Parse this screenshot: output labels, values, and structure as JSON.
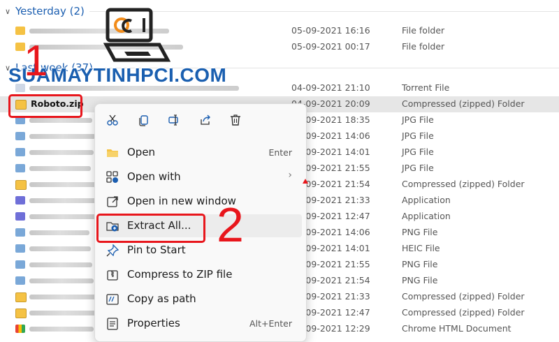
{
  "groups": [
    {
      "label": "Yesterday (2)"
    },
    {
      "label": "Last week (37)"
    }
  ],
  "yesterday_rows": [
    {
      "date": "05-09-2021 16:16",
      "type": "File folder",
      "icon": "folder-icon"
    },
    {
      "date": "05-09-2021 00:17",
      "type": "File folder",
      "icon": "folder-icon"
    }
  ],
  "lastweek_rows": [
    {
      "date": "04-09-2021 21:10",
      "type": "Torrent File",
      "icon": "file-icon"
    },
    {
      "name": "Roboto.zip",
      "date": "04-09-2021 20:09",
      "type": "Compressed (zipped) Folder",
      "icon": "zip-folder-icon",
      "selected": true
    },
    {
      "date": "04-09-2021 18:35",
      "type": "JPG File",
      "icon": "image-icon"
    },
    {
      "date": "04-09-2021 14:06",
      "type": "JPG File",
      "icon": "image-icon"
    },
    {
      "date": "04-09-2021 14:01",
      "type": "JPG File",
      "icon": "image-icon"
    },
    {
      "date": "04-09-2021 21:55",
      "type": "JPG File",
      "icon": "image-icon"
    },
    {
      "date": "04-09-2021 21:54",
      "type": "Compressed (zipped) Folder",
      "icon": "zip-folder-icon"
    },
    {
      "date": "04-09-2021 21:33",
      "type": "Application",
      "icon": "app-icon"
    },
    {
      "date": "04-09-2021 12:47",
      "type": "Application",
      "icon": "app-icon"
    },
    {
      "date": "04-09-2021 14:06",
      "type": "PNG File",
      "icon": "image-icon"
    },
    {
      "date": "04-09-2021 14:01",
      "type": "HEIC File",
      "icon": "image-icon"
    },
    {
      "date": "04-09-2021 21:55",
      "type": "PNG File",
      "icon": "image-icon"
    },
    {
      "date": "04-09-2021 21:54",
      "type": "PNG File",
      "icon": "image-icon"
    },
    {
      "date": "04-09-2021 21:33",
      "type": "Compressed (zipped) Folder",
      "icon": "zip-folder-icon"
    },
    {
      "date": "04-09-2021 12:47",
      "type": "Compressed (zipped) Folder",
      "icon": "zip-folder-icon"
    },
    {
      "date": "04-09-2021 12:29",
      "type": "Chrome HTML Document",
      "icon": "html-icon"
    }
  ],
  "context_menu": {
    "toolbar": [
      {
        "icon": "cut-icon"
      },
      {
        "icon": "copy-icon"
      },
      {
        "icon": "rename-icon"
      },
      {
        "icon": "share-icon"
      },
      {
        "icon": "delete-icon"
      }
    ],
    "items": [
      {
        "label": "Open",
        "shortcut": "Enter",
        "icon": "folder-open-icon"
      },
      {
        "label": "Open with",
        "shortcut": "",
        "icon": "open-with-icon",
        "submenu": true
      },
      {
        "label": "Open in new window",
        "shortcut": "",
        "icon": "new-window-icon"
      },
      {
        "label": "Extract All...",
        "shortcut": "",
        "icon": "extract-icon",
        "highlighted": true
      },
      {
        "label": "Pin to Start",
        "shortcut": "",
        "icon": "pin-icon"
      },
      {
        "label": "Compress to ZIP file",
        "shortcut": "",
        "icon": "zip-icon"
      },
      {
        "label": "Copy as path",
        "shortcut": "",
        "icon": "copy-path-icon"
      },
      {
        "label": "Properties",
        "shortcut": "Alt+Enter",
        "icon": "properties-icon"
      }
    ]
  },
  "annotations": {
    "step1": "1",
    "step2": "2"
  },
  "watermark": "SUAMAYTINHPCI.COM",
  "colors": {
    "accent": "#1b5eb0",
    "callout": "#e8161c",
    "selected_row": "#e6e6e6"
  }
}
